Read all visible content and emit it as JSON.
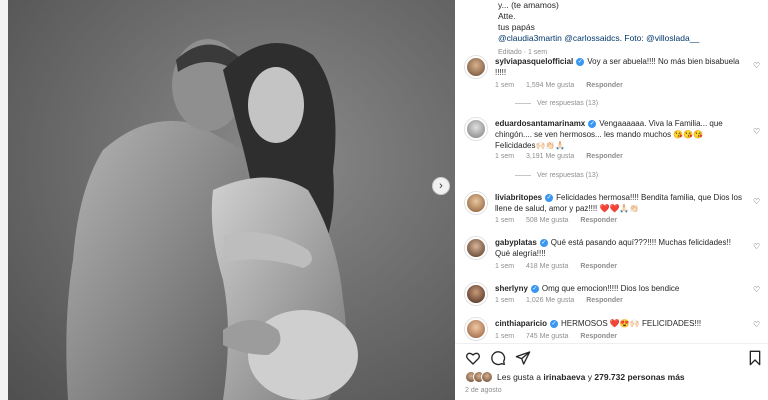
{
  "caption": {
    "line1": "y... (te amamos)",
    "line2": "Atte.",
    "line3": "tus papás",
    "tags": "@claudia3martin @carlossaidcs. Foto: @villoslada__",
    "meta": "Editado · 1 sem"
  },
  "comments": [
    {
      "user": "sylviapasquelofficial",
      "text": "Voy a ser abuela!!!! No más bien bisabuela !!!!!",
      "time": "1 sem",
      "likes": "1,594 Me gusta",
      "reply": "Responder",
      "replies": "Ver respuestas (13)"
    },
    {
      "user": "eduardosantamarinamx",
      "text": "Vengaaaaaa. Viva la Familia... que chingón.... se ven hermosos... les mando muchos 😘😘😘 Felicidades🙌🏻👏🏻🙏🏻",
      "time": "1 sem",
      "likes": "3,191 Me gusta",
      "reply": "Responder",
      "replies": "Ver respuestas (13)"
    },
    {
      "user": "liviabritopes",
      "text": "Felicidades hermosa!!!! Bendita familia, que Dios los llene de salud, amor y paz!!!! ❤️❤️🙏🏻👏🏻",
      "time": "1 sem",
      "likes": "508 Me gusta",
      "reply": "Responder"
    },
    {
      "user": "gabyplatas",
      "text": "Qué está pasando aquí???!!!! Muchas felicidades!! Qué alegría!!!!",
      "time": "1 sem",
      "likes": "418 Me gusta",
      "reply": "Responder"
    },
    {
      "user": "sherlyny",
      "text": "Omg que emocion!!!!! Dios los bendice",
      "time": "1 sem",
      "likes": "1,026 Me gusta",
      "reply": "Responder"
    },
    {
      "user": "cinthiaparicio",
      "text": "HERMOSOS ❤️😍🙌🏻 FELICIDADES!!!",
      "time": "1 sem",
      "likes": "745 Me gusta",
      "reply": "Responder"
    }
  ],
  "likes": {
    "prefix": "Les gusta a",
    "user": "irinabaeva",
    "middle": "y",
    "count": "279.732 personas más"
  },
  "date": "2 de agosto",
  "icons": [
    "heart-icon",
    "comment-icon",
    "share-icon",
    "bookmark-icon",
    "chevron-right-icon"
  ]
}
